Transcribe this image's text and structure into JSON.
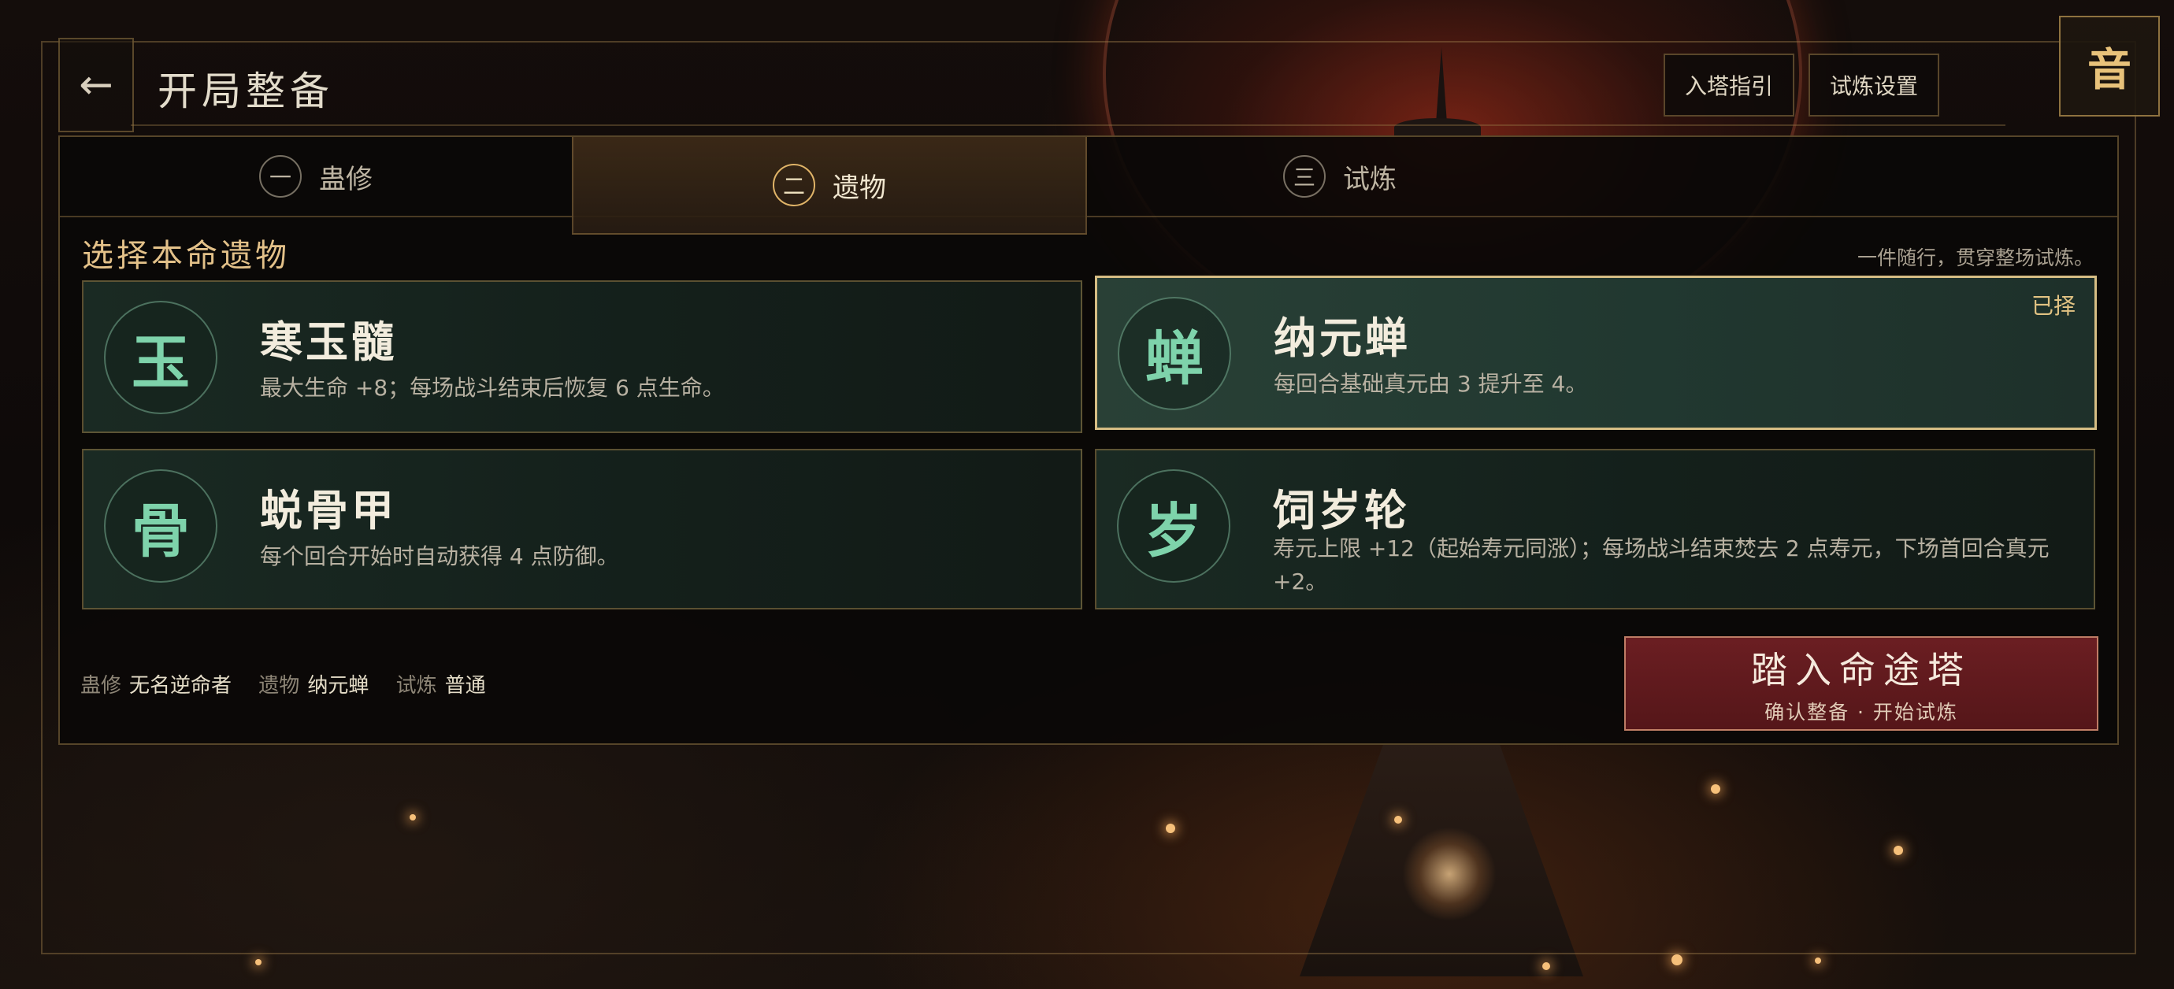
{
  "header": {
    "back_icon": "arrow-left-icon",
    "back_glyph": "←",
    "title": "开局整备",
    "buttons": [
      {
        "label": "入塔指引"
      },
      {
        "label": "试炼设置"
      }
    ],
    "sound_label": "音"
  },
  "tabs": [
    {
      "num": "一",
      "label": "蛊修",
      "active": false
    },
    {
      "num": "二",
      "label": "遗物",
      "active": true
    },
    {
      "num": "三",
      "label": "试炼",
      "active": false
    }
  ],
  "section": {
    "title": "选择本命遗物",
    "note": "一件随行，贯穿整场试炼。"
  },
  "relics": [
    {
      "icon": "玉",
      "name": "寒玉髓",
      "desc": "最大生命 +8；每场战斗结束后恢复 6 点生命。",
      "selected": false,
      "tag": ""
    },
    {
      "icon": "蝉",
      "name": "纳元蝉",
      "desc": "每回合基础真元由 3 提升至 4。",
      "selected": true,
      "tag": "已择"
    },
    {
      "icon": "骨",
      "name": "蜕骨甲",
      "desc": "每个回合开始时自动获得 4 点防御。",
      "selected": false,
      "tag": ""
    },
    {
      "icon": "岁",
      "name": "饲岁轮",
      "desc": "寿元上限 +12（起始寿元同涨）；每场战斗结束焚去 2 点寿元，下场首回合真元 +2。",
      "selected": false,
      "tag": ""
    }
  ],
  "summary": [
    {
      "label": "蛊修",
      "value": "无名逆命者"
    },
    {
      "label": "遗物",
      "value": "纳元蝉"
    },
    {
      "label": "试炼",
      "value": "普通"
    }
  ],
  "start": {
    "main": "踏入命途塔",
    "sub": "确认整备 · 开始试炼"
  },
  "colors": {
    "accent_gold": "#e3c189",
    "relic_green": "#7ed3ab",
    "start_red": "#6b1e22",
    "selected_border": "#d6bd84"
  }
}
